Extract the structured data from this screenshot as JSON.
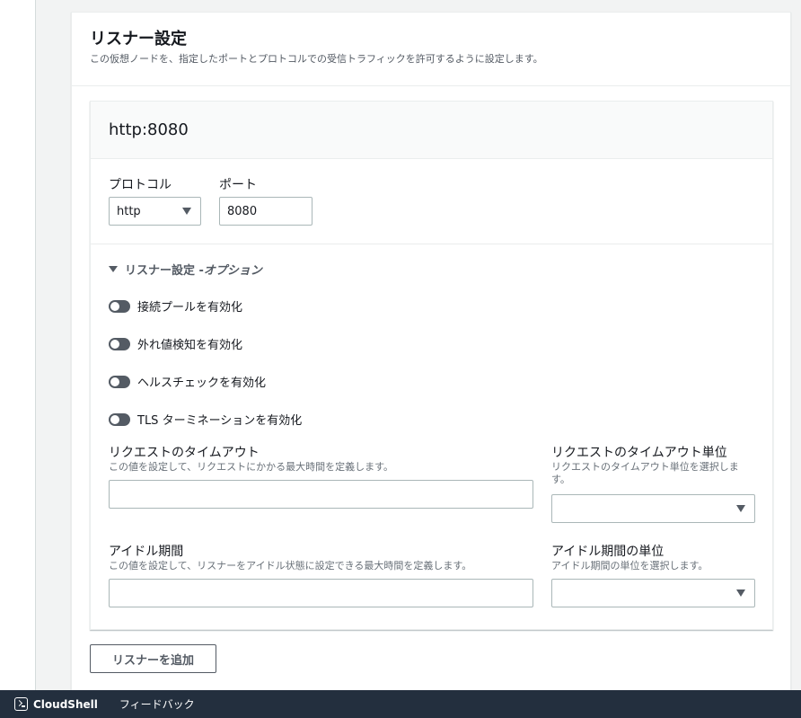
{
  "section": {
    "title": "リスナー設定",
    "description": "この仮想ノードを、指定したポートとプロトコルでの受信トラフィックを許可するように設定します。"
  },
  "listener": {
    "title": "http:8080",
    "protocol_label": "プロトコル",
    "protocol_value": "http",
    "port_label": "ポート",
    "port_value": "8080"
  },
  "options": {
    "heading_prefix": "リスナー設定 - ",
    "heading_suffix": "オプション",
    "toggles": [
      {
        "label": "接続プールを有効化",
        "enabled": false
      },
      {
        "label": "外れ値検知を有効化",
        "enabled": false
      },
      {
        "label": "ヘルスチェックを有効化",
        "enabled": false
      },
      {
        "label": "TLS ターミネーションを有効化",
        "enabled": false
      }
    ],
    "request_timeout": {
      "label": "リクエストのタイムアウト",
      "description": "この値を設定して、リクエストにかかる最大時間を定義します。",
      "value": ""
    },
    "request_timeout_unit": {
      "label": "リクエストのタイムアウト単位",
      "description": "リクエストのタイムアウト単位を選択します。",
      "value": ""
    },
    "idle_duration": {
      "label": "アイドル期間",
      "description": "この値を設定して、リスナーをアイドル状態に設定できる最大時間を定義します。",
      "value": ""
    },
    "idle_duration_unit": {
      "label": "アイドル期間の単位",
      "description": "アイドル期間の単位を選択します。",
      "value": ""
    }
  },
  "add_listener_label": "リスナーを追加",
  "footer": {
    "cloudshell_label": "CloudShell",
    "feedback_label": "フィードバック"
  },
  "colors": {
    "footer_bg": "#232f3e",
    "toggle_off": "#545b64",
    "border": "#aab7b8"
  }
}
